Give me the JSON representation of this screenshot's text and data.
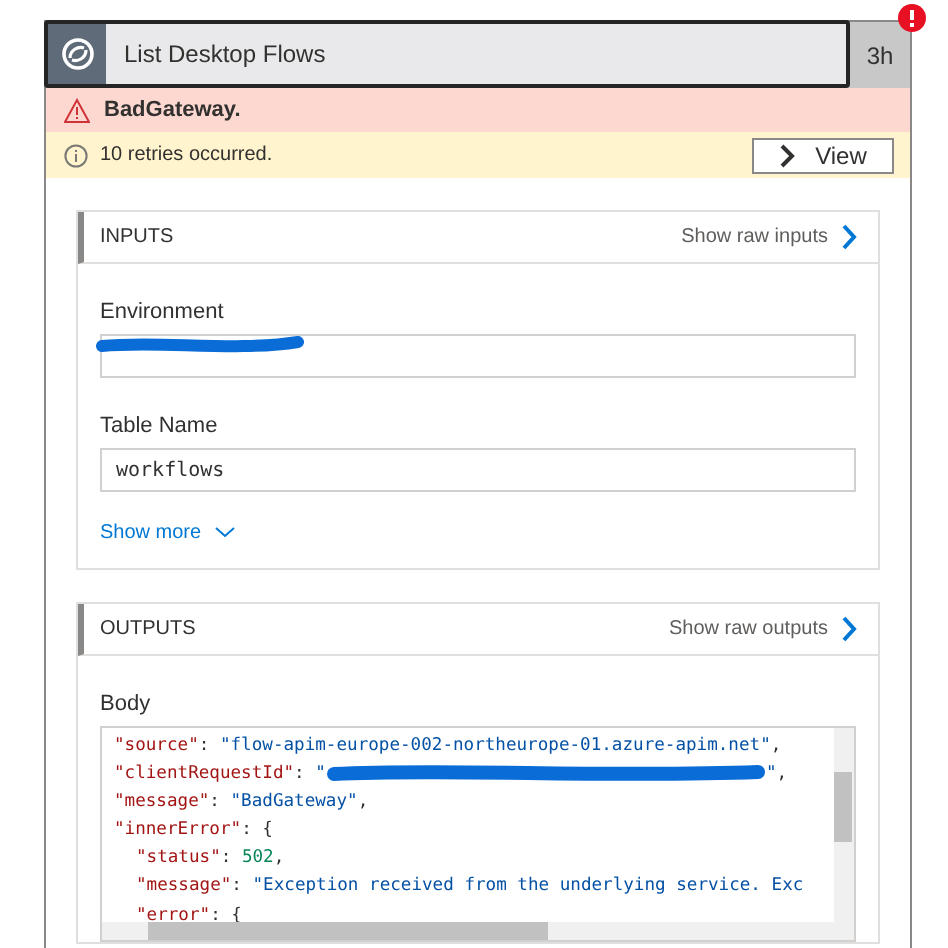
{
  "action": {
    "title": "List Desktop Flows",
    "duration": "3h",
    "failed": true
  },
  "error": {
    "message": "BadGateway."
  },
  "retries": {
    "message": "10 retries occurred.",
    "button": "View"
  },
  "inputs": {
    "title": "INPUTS",
    "raw_link": "Show raw inputs",
    "fields": [
      {
        "label": "Environment",
        "redacted": true
      },
      {
        "label": "Table Name",
        "value": "workflows",
        "redacted": false
      }
    ],
    "show_more": "Show more"
  },
  "outputs": {
    "title": "OUTPUTS",
    "raw_link": "Show raw outputs",
    "body_label": "Body",
    "body_lines": [
      {
        "tokens": [
          {
            "kind": "key",
            "text": "\"source\""
          },
          {
            "kind": "punct",
            "text": ": "
          },
          {
            "kind": "string",
            "text": "\"flow-apim-europe-002-northeurope-01.azure-apim.net\""
          },
          {
            "kind": "punct",
            "text": ","
          }
        ]
      },
      {
        "tokens": [
          {
            "kind": "key",
            "text": "\"clientRequestId\""
          },
          {
            "kind": "punct",
            "text": ": "
          },
          {
            "kind": "string",
            "text": "\""
          },
          {
            "kind": "redacted"
          },
          {
            "kind": "string",
            "text": "\""
          },
          {
            "kind": "punct",
            "text": ","
          }
        ]
      },
      {
        "tokens": [
          {
            "kind": "key",
            "text": "\"message\""
          },
          {
            "kind": "punct",
            "text": ": "
          },
          {
            "kind": "string",
            "text": "\"BadGateway\""
          },
          {
            "kind": "punct",
            "text": ","
          }
        ]
      },
      {
        "tokens": [
          {
            "kind": "key",
            "text": "\"innerError\""
          },
          {
            "kind": "punct",
            "text": ": {"
          }
        ],
        "children": [
          {
            "tokens": [
              {
                "kind": "key",
                "text": "\"status\""
              },
              {
                "kind": "punct",
                "text": ": "
              },
              {
                "kind": "number",
                "text": "502"
              },
              {
                "kind": "punct",
                "text": ","
              }
            ]
          },
          {
            "tokens": [
              {
                "kind": "key",
                "text": "\"message\""
              },
              {
                "kind": "punct",
                "text": ": "
              },
              {
                "kind": "string",
                "text": "\"Exception received from the underlying service. Exc"
              }
            ]
          },
          {
            "tokens": [
              {
                "kind": "key",
                "text": "\"error\""
              },
              {
                "kind": "punct",
                "text": ": {"
              }
            ]
          }
        ]
      }
    ]
  }
}
